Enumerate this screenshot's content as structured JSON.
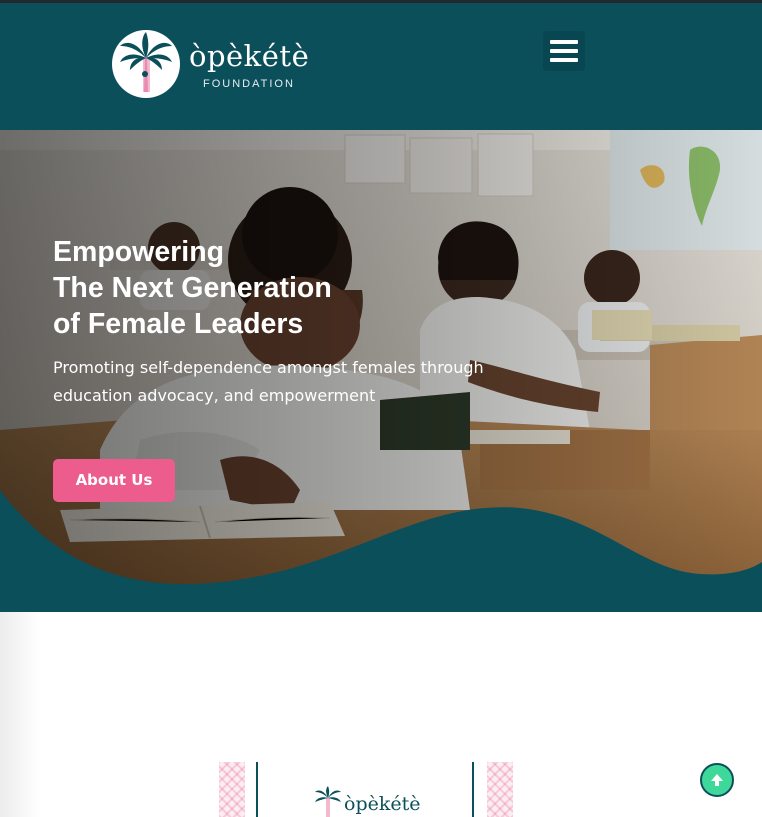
{
  "header": {
    "brand_name": "òpèkétè",
    "brand_tagline": "FOUNDATION",
    "menu_icon": "hamburger-menu-icon",
    "background_color": "#0b4f5a"
  },
  "hero": {
    "title_lines": [
      "Empowering",
      "The Next Generation",
      "of Female Leaders"
    ],
    "subtitle_lines": [
      "Promoting self-dependence amongst females through",
      "education advocacy, and empowerment"
    ],
    "cta_label": "About Us",
    "cta_color": "#ec5c8c",
    "image_subject": "girl reading a book in a classroom"
  },
  "about_card": {
    "brand_name": "òpèkétè"
  },
  "scroll_top": {
    "icon": "arrow-up-icon",
    "color": "#3ed99a"
  }
}
